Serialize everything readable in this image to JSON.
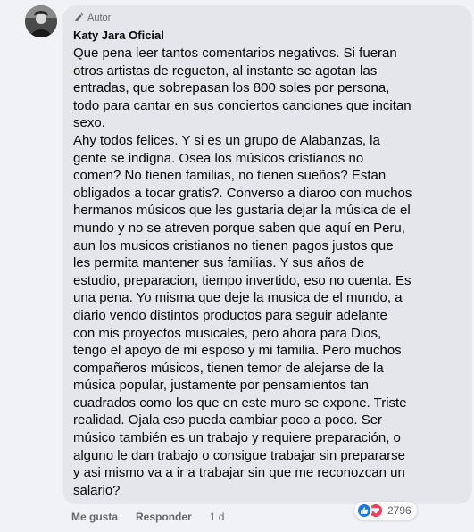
{
  "comment": {
    "badge_label": "Autor",
    "author_name": "Katy Jara Oficial",
    "text_paragraphs": [
      "Que pena leer tantos comentarios negativos. Si fueran otros artistas de regueton, al instante se agotan las entradas, que sobrepasan los 800 soles por persona, todo para cantar en sus conciertos canciones que incitan sexo.",
      "Ahy todos felices. Y si es un grupo de Alabanzas, la gente se indigna. Osea los músicos cristianos no comen? No tienen familias, no tienen sueños? Estan obligados a tocar gratis?. Converso a diaroo con muchos hermanos músicos que les gustaria dejar la música de el mundo y no se atreven porque saben que aquí en Peru, aun los musicos cristianos no tienen pagos justos que les permita mantener sus familias. Y sus años de estudio, preparacion, tiempo invertido, eso no cuenta. Es una pena. Yo misma que deje la musica de el mundo, a diario vendo distintos productos para seguir adelante con mis proyectos musicales, pero ahora para Dios, tengo el apoyo de mi esposo y mi familia. Pero muchos compañeros músicos, tienen temor de alejarse de la música popular, justamente por pensamientos tan cuadrados como los que en este muro se expone. Triste realidad. Ojala eso pueda cambiar poco a poco. Ser músico también es un trabajo y requiere preparación, o alguno le dan trabajo o consigue trabajar sin prepararse y asi mismo va a ir a trabajar sin que me reconozcan un salario?"
    ],
    "actions": {
      "like_label": "Me gusta",
      "reply_label": "Responder",
      "time_label": "1 d"
    },
    "reactions": {
      "icons": [
        "like-icon",
        "love-icon"
      ],
      "count": "2796"
    }
  },
  "colors": {
    "page_bg": "#f0f2f5",
    "bubble_bg": "#e4e6eb",
    "text": "#050505",
    "secondary_text": "#65676b",
    "like_blue": "#1877f2",
    "love_red": "#f33e58"
  }
}
